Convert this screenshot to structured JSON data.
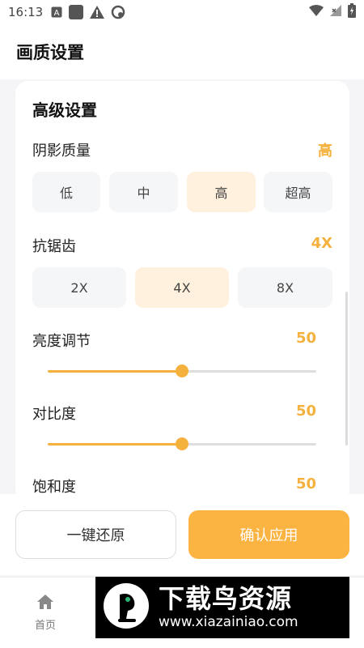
{
  "status_bar": {
    "time": "16:13",
    "icons": [
      "a-box-icon",
      "square-icon",
      "warning-icon",
      "circle-icon",
      "wifi-icon",
      "signal-icon",
      "battery-icon"
    ]
  },
  "header": {
    "title": "画质设置"
  },
  "advanced": {
    "title": "高级设置",
    "shadow": {
      "label": "阴影质量",
      "value": "高",
      "options": [
        "低",
        "中",
        "高",
        "超高"
      ],
      "selected_index": 2
    },
    "antialias": {
      "label": "抗锯齿",
      "value": "4X",
      "options": [
        "2X",
        "4X",
        "8X"
      ],
      "selected_index": 1
    },
    "brightness": {
      "label": "亮度调节",
      "value": "50",
      "level": 0.5
    },
    "contrast": {
      "label": "对比度",
      "value": "50",
      "level": 0.5
    },
    "saturation": {
      "label": "饱和度",
      "value": "50",
      "level": 0.5
    }
  },
  "actions": {
    "reset_label": "一键还原",
    "apply_label": "确认应用"
  },
  "bottom_nav": {
    "home_label": "首页"
  },
  "watermark": {
    "brand": "下载鸟资源",
    "url": "www.xiazainiao.com"
  },
  "colors": {
    "accent": "#f5b13d",
    "apply_button": "#fbb342",
    "selected_bg": "#fff1de",
    "option_bg": "#f5f6f8"
  }
}
